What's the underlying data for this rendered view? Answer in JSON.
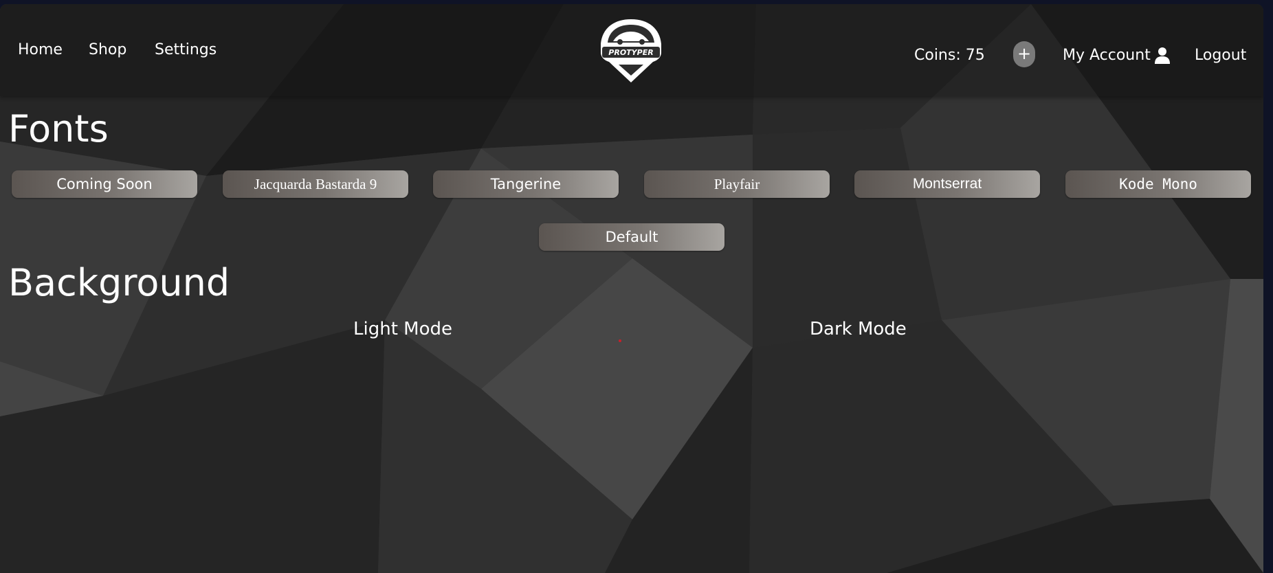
{
  "nav": {
    "home": "Home",
    "shop": "Shop",
    "settings": "Settings",
    "logo_text": "PROTYPER",
    "coins": "Coins: 75",
    "add_coins": "+",
    "account": "My Account",
    "logout": "Logout"
  },
  "fonts_section": {
    "title": "Fonts",
    "buttons": [
      "Coming Soon",
      "Jacquarda Bastarda 9",
      "Tangerine",
      "Playfair",
      "Montserrat",
      "Kode Mono"
    ],
    "default_button": "Default"
  },
  "background_section": {
    "title": "Background",
    "light_mode": "Light Mode",
    "dark_mode": "Dark Mode"
  },
  "colors": {
    "text": "#ffffff",
    "button_gradient_start": "#5b5551",
    "button_gradient_end": "#a8a5a1",
    "accent_dot": "#c8202a"
  }
}
